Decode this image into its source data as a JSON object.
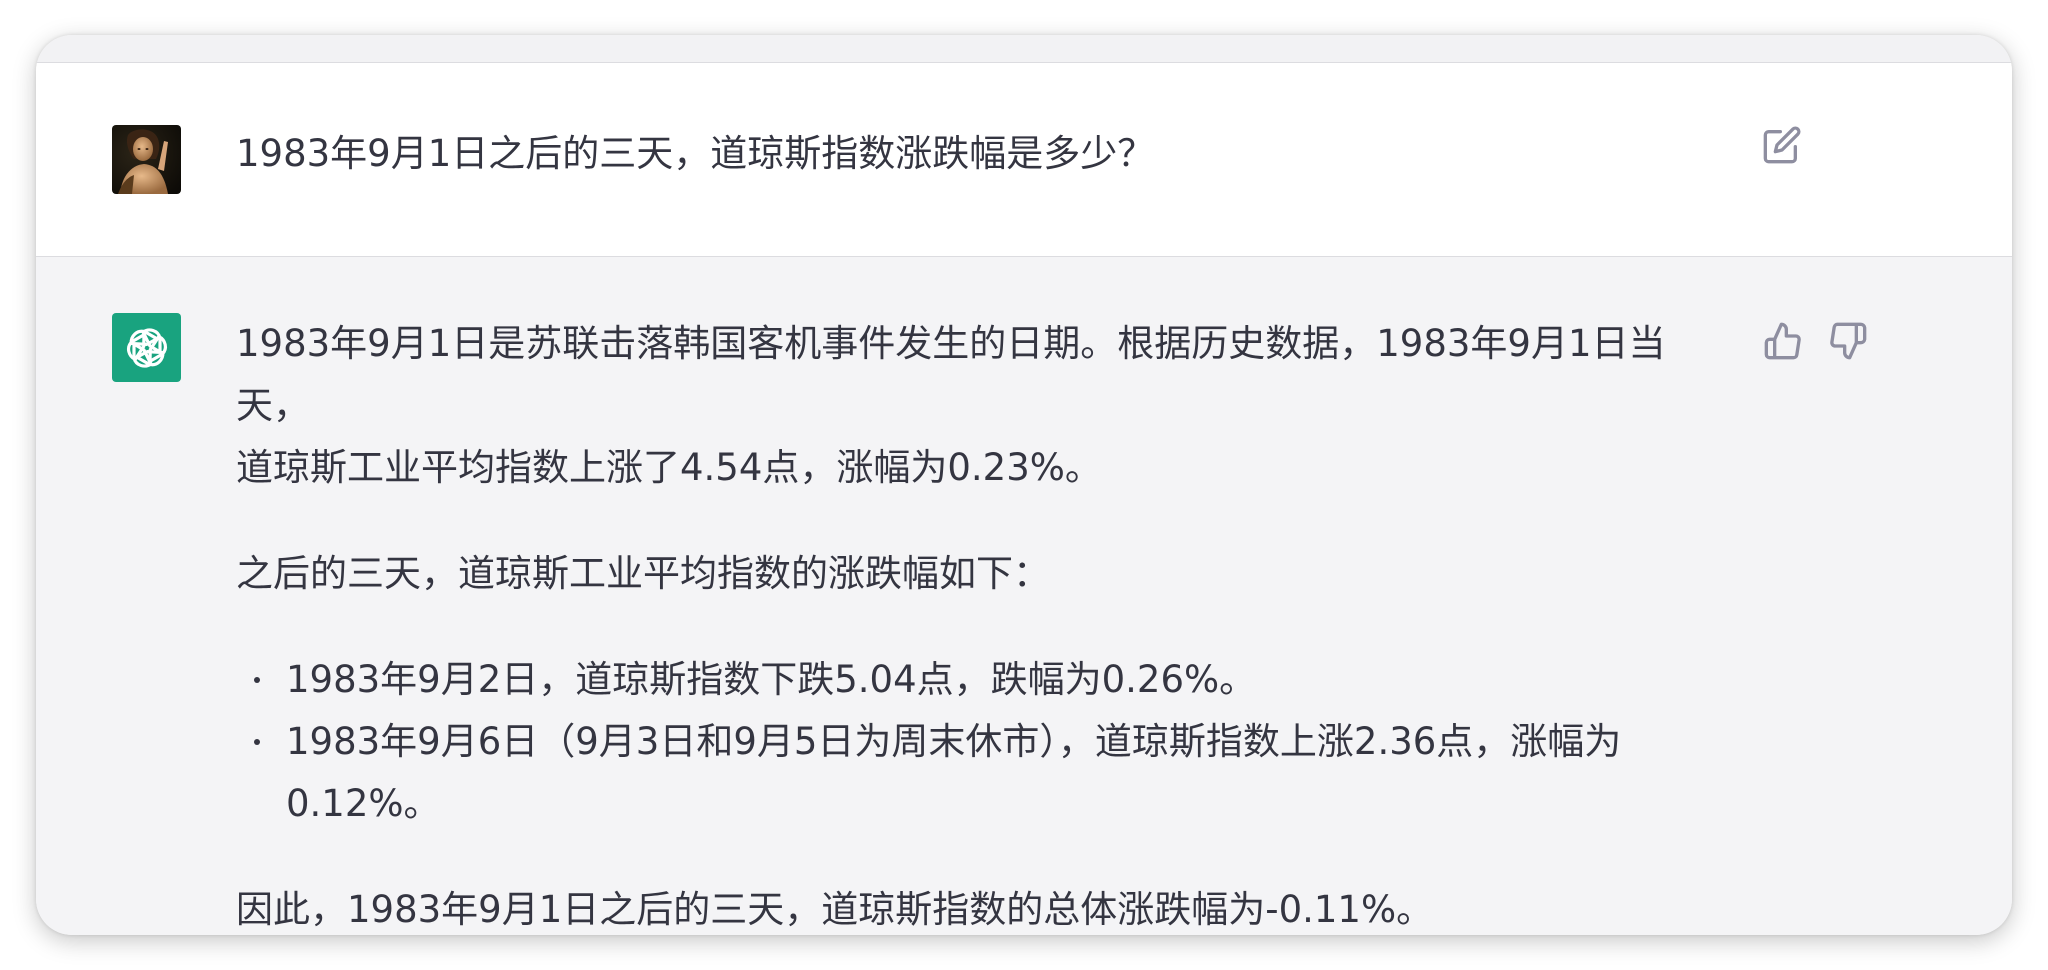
{
  "conversation": {
    "user_message": {
      "text": "1983年9月1日之后的三天，道琼斯指数涨跌幅是多少？",
      "avatar": "user-avatar-portrait",
      "actions": [
        "edit-icon"
      ]
    },
    "assistant_message": {
      "avatar": "openai-logo-icon",
      "avatar_color": "#19a37f",
      "paragraph1_line1": "1983年9月1日是苏联击落韩国客机事件发生的日期。根据历史数据，1983年9月1日当天，",
      "paragraph1_line2": "道琼斯工业平均指数上涨了4.54点，涨幅为0.23%。",
      "paragraph2": "之后的三天，道琼斯工业平均指数的涨跌幅如下：",
      "bullets": [
        "1983年9月2日，道琼斯指数下跌5.04点，跌幅为0.26%。",
        "1983年9月6日（9月3日和9月5日为周末休市），道琼斯指数上涨2.36点，涨幅为0.12%。"
      ],
      "conclusion": "因此，1983年9月1日之后的三天，道琼斯指数的总体涨跌幅为-0.11%。",
      "actions": [
        "thumbs-up-icon",
        "thumbs-down-icon"
      ]
    }
  },
  "colors": {
    "text": "#343541",
    "icon": "#8e8ea0",
    "user_bg": "#ffffff",
    "assistant_bg": "#f4f4f6"
  }
}
